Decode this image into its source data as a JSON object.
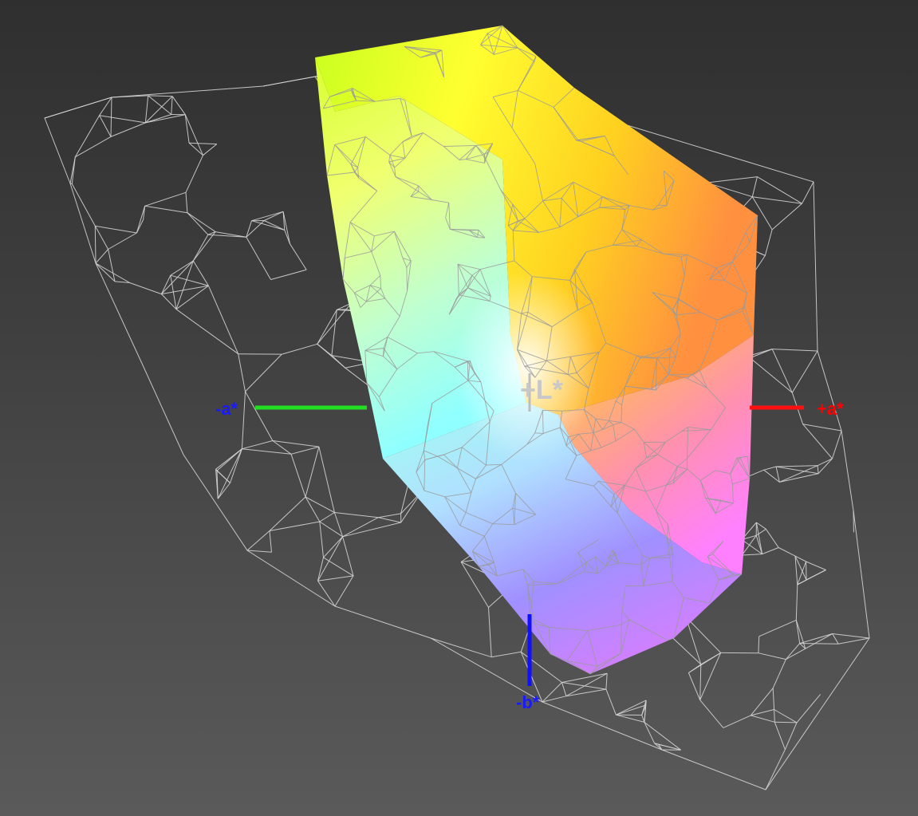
{
  "chart_data": {
    "type": "3d-gamut",
    "axes": {
      "pos_a": {
        "label": "+a*",
        "color": "#ff0000"
      },
      "neg_a": {
        "label": "-a*",
        "color": "#1a1aff"
      },
      "neg_b": {
        "label": "-b*",
        "color": "#1a1aff"
      },
      "pos_l": {
        "label": "+L*",
        "color": "#c8c8c8"
      }
    },
    "axis_colors": {
      "a_positive": "#ff1010",
      "a_negative": "#22dd22",
      "b_negative": "#1010ff"
    },
    "series": [
      {
        "style": "solid-color",
        "colors": [
          "#ffff00",
          "#ff8040",
          "#ff80ff",
          "#8080ff",
          "#80ffff",
          "#c0ff40",
          "#ffffff"
        ]
      },
      {
        "style": "wireframe",
        "color": "#cfcfcf"
      }
    ],
    "background": "#3a3a3a"
  }
}
